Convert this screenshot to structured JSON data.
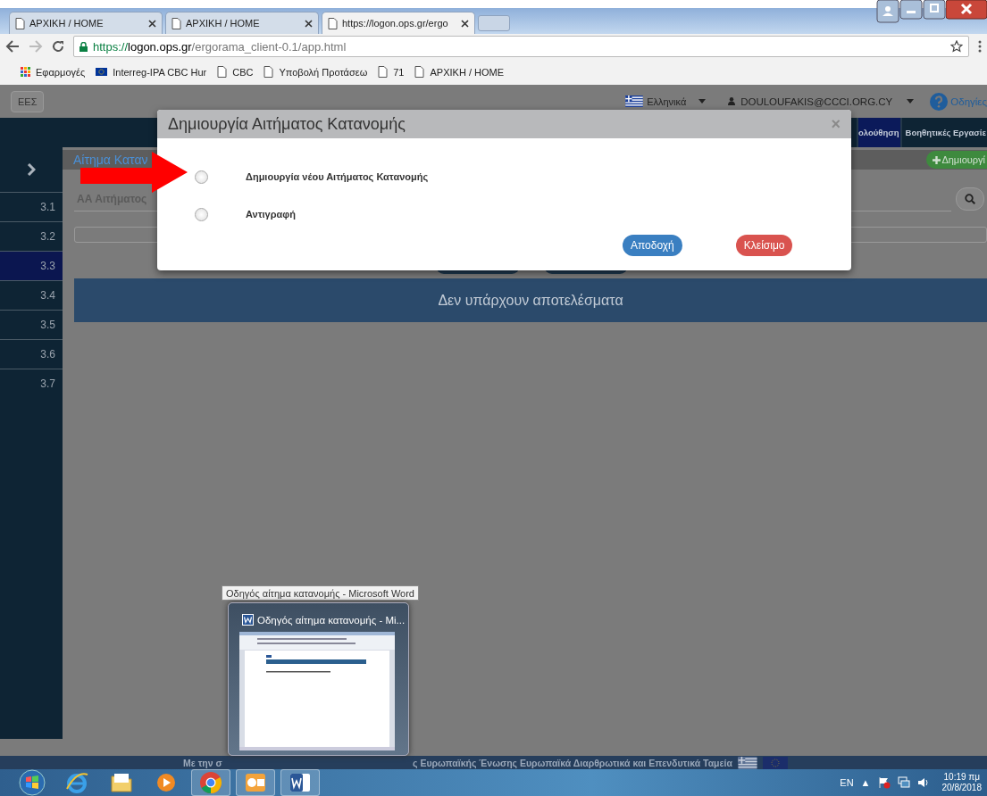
{
  "browser": {
    "tabs": [
      {
        "title": "ΑΡΧΙΚΗ / HOME",
        "selected": false
      },
      {
        "title": "ΑΡΧΙΚΗ / HOME",
        "selected": false
      },
      {
        "title": "https://logon.ops.gr/ergo",
        "selected": true
      }
    ],
    "address": {
      "scheme": "https://",
      "host": "logon.ops.gr",
      "path": "/ergorama_client-0.1/app.html"
    },
    "bookmarks": [
      {
        "label": "Εφαρμογές",
        "kind": "apps"
      },
      {
        "label": "Interreg-IPA CBC Hur",
        "kind": "flag"
      },
      {
        "label": "CBC",
        "kind": "page"
      },
      {
        "label": "Υποβολή Προτάσεω",
        "kind": "page"
      },
      {
        "label": "71",
        "kind": "page"
      },
      {
        "label": "ΑΡΧΙΚΗ / HOME",
        "kind": "page"
      }
    ]
  },
  "header": {
    "program_button": "ΕΕΣ",
    "language": "Ελληνικά",
    "user": "DOULOUFAKIS@CCCI.ORG.CY",
    "help": "Οδηγίες"
  },
  "nav": [
    {
      "label": "ολούθηση",
      "selected": true
    },
    {
      "label": "Βοηθητικές Εργασίε",
      "selected": false
    }
  ],
  "sidebar": {
    "items": [
      {
        "label": "3.1",
        "selected": false
      },
      {
        "label": "3.2",
        "selected": false
      },
      {
        "label": "3.3",
        "selected": true
      },
      {
        "label": "3.4",
        "selected": false
      },
      {
        "label": "3.5",
        "selected": false
      },
      {
        "label": "3.6",
        "selected": false
      },
      {
        "label": "3.7",
        "selected": false
      }
    ]
  },
  "page": {
    "title": "Αίτημα Καταν",
    "create_button": "Δημιουργί",
    "field_label": "ΑΑ Αιτήματος",
    "empty_message": "Δεν υπάρχουν αποτελέσματα"
  },
  "dialog": {
    "title": "Δημιουργία Αιτήματος Κατανομής",
    "close": "×",
    "options": [
      {
        "label": "Δημιουργία νέου Αιτήματος Κατανομής",
        "selected": false
      },
      {
        "label": "Αντιγραφή",
        "selected": false
      }
    ],
    "buttons": [
      {
        "label": "Αποδοχή",
        "kind": "primary"
      },
      {
        "label": "Κλείσιμο",
        "kind": "danger"
      }
    ]
  },
  "footer": {
    "text_start": "Με την σ",
    "text_end": "ς Ευρωπαϊκής Ένωσης Ευρωπαϊκά Διαρθρωτικά και Επενδυτικά Ταμεία"
  },
  "taskbar": {
    "preview": {
      "tooltip": "Οδηγός αίτημα κατανομής - Microsoft Word",
      "title": "Οδηγός αίτημα κατανομής - Mi..."
    },
    "language": "EN",
    "tray_expand": "▲",
    "time": "10:19 πμ",
    "date": "20/8/2018"
  }
}
